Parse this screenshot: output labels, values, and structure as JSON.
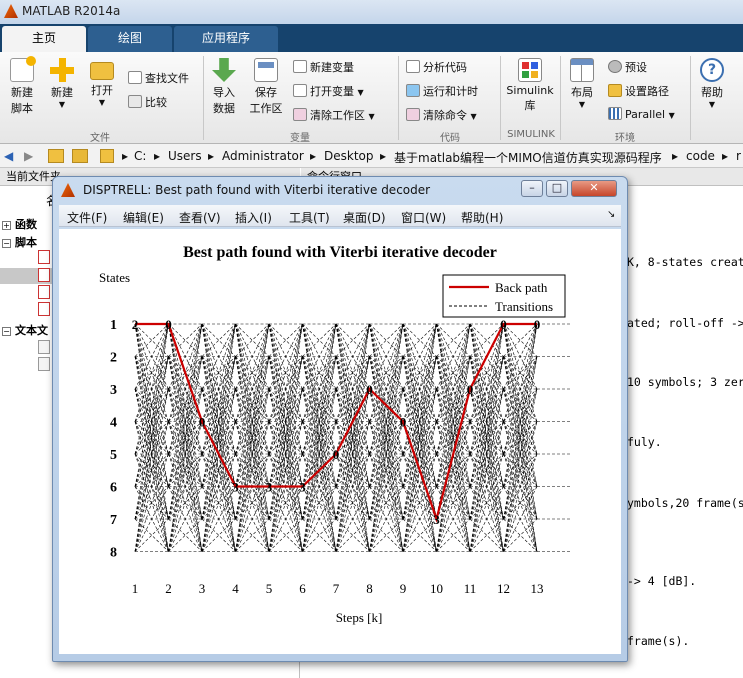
{
  "app": {
    "title": "MATLAB R2014a"
  },
  "tabs": [
    "主页",
    "绘图",
    "应用程序"
  ],
  "ribbon": {
    "new_script": [
      "新建",
      "脚本"
    ],
    "new": "新建",
    "open": "打开",
    "find_files": "查找文件",
    "compare": "比较",
    "import": [
      "导入",
      "数据"
    ],
    "save_ws": [
      "保存",
      "工作区"
    ],
    "new_var": "新建变量",
    "open_var": "打开变量",
    "clear_ws": "清除工作区",
    "analyze": "分析代码",
    "run_time": "运行和计时",
    "clear_cmd": "清除命令",
    "simulink": [
      "Simulink",
      "库"
    ],
    "layout": "布局",
    "prefs": "预设",
    "set_path": "设置路径",
    "parallel": "Parallel",
    "help": "帮助",
    "groups": {
      "file": "文件",
      "variable": "变量",
      "code": "代码",
      "simulink": "SIMULINK",
      "env": "环境"
    }
  },
  "address": [
    "C:",
    "Users",
    "Administrator",
    "Desktop",
    "基于matlab编程一个MIMO信道仿真实现源码程序",
    "code",
    "r"
  ],
  "left_pane": {
    "header": "当前文件夹",
    "name_col": "名",
    "tree": [
      "函数",
      "脚本",
      "文本文"
    ]
  },
  "right_pane": {
    "header": "命令行窗口",
    "lines": [
      "K, 8-states creat",
      "ated; roll-off ->",
      "10 symbols; 3 zer",
      "fuly.",
      "ymbols,20 frame(s",
      "-> 4 [dB].",
      "frame(s)."
    ]
  },
  "figure": {
    "title": "DISPTRELL: Best path found with Viterbi iterative decoder",
    "menu": [
      "文件(F)",
      "编辑(E)",
      "查看(V)",
      "插入(I)",
      "工具(T)",
      "桌面(D)",
      "窗口(W)",
      "帮助(H)"
    ],
    "colors": {
      "path": "#cc0000",
      "transitions": "#000000"
    }
  },
  "chart_data": {
    "type": "line",
    "title": "Best path found with Viterbi iterative decoder",
    "xlabel": "Steps [k]",
    "ylabel": "States",
    "x_ticks": [
      1,
      2,
      3,
      4,
      5,
      6,
      7,
      8,
      9,
      10,
      11,
      12,
      13
    ],
    "y_ticks": [
      1,
      2,
      3,
      4,
      5,
      6,
      7,
      8
    ],
    "y_reversed": true,
    "legend": {
      "entries": [
        "Back path",
        "Transitions"
      ],
      "placement": "top-right"
    },
    "series": [
      {
        "name": "Back path",
        "x": [
          1,
          2,
          3,
          4,
          5,
          6,
          7,
          8,
          9,
          10,
          11,
          12,
          13
        ],
        "y": [
          1,
          1,
          4,
          6,
          6,
          6,
          5,
          3,
          4,
          7,
          3,
          1,
          1
        ],
        "point_labels": [
          "2",
          "0",
          "0",
          "3",
          "3",
          "3",
          "0",
          "0",
          "0",
          "3",
          "0",
          "0",
          "0"
        ]
      }
    ],
    "transitions": "all-to-all between consecutive steps (trellis, 8 states)"
  }
}
